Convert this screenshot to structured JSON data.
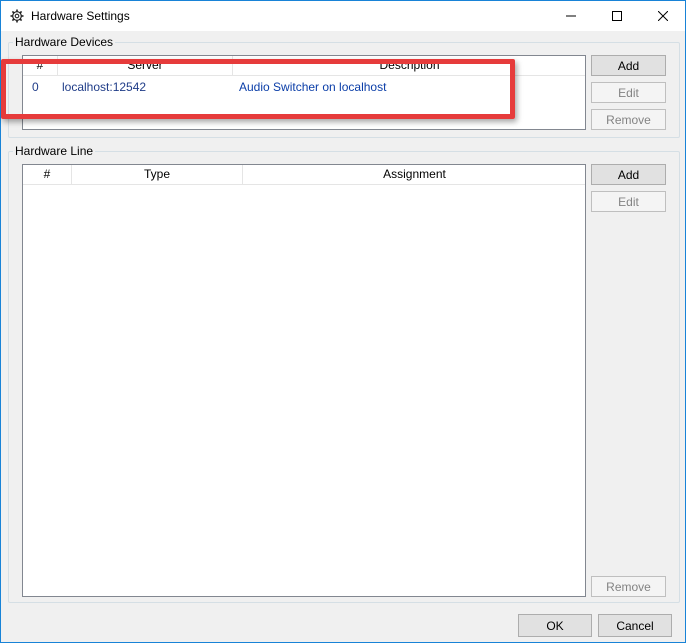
{
  "window": {
    "title": "Hardware Settings"
  },
  "hardware_devices": {
    "label": "Hardware Devices",
    "columns": [
      "#",
      "Server",
      "Description"
    ],
    "rows": [
      {
        "num": "0",
        "server": "localhost:12542",
        "description": "Audio Switcher on localhost"
      }
    ],
    "buttons": {
      "add": "Add",
      "edit": "Edit",
      "remove": "Remove"
    }
  },
  "hardware_line": {
    "label": "Hardware Line",
    "columns": [
      "#",
      "Type",
      "Assignment"
    ],
    "rows": [],
    "buttons": {
      "add": "Add",
      "edit": "Edit",
      "remove": "Remove"
    }
  },
  "footer": {
    "ok": "OK",
    "cancel": "Cancel"
  },
  "colors": {
    "highlight": "#e63b3b",
    "accent": "#1883d7"
  }
}
